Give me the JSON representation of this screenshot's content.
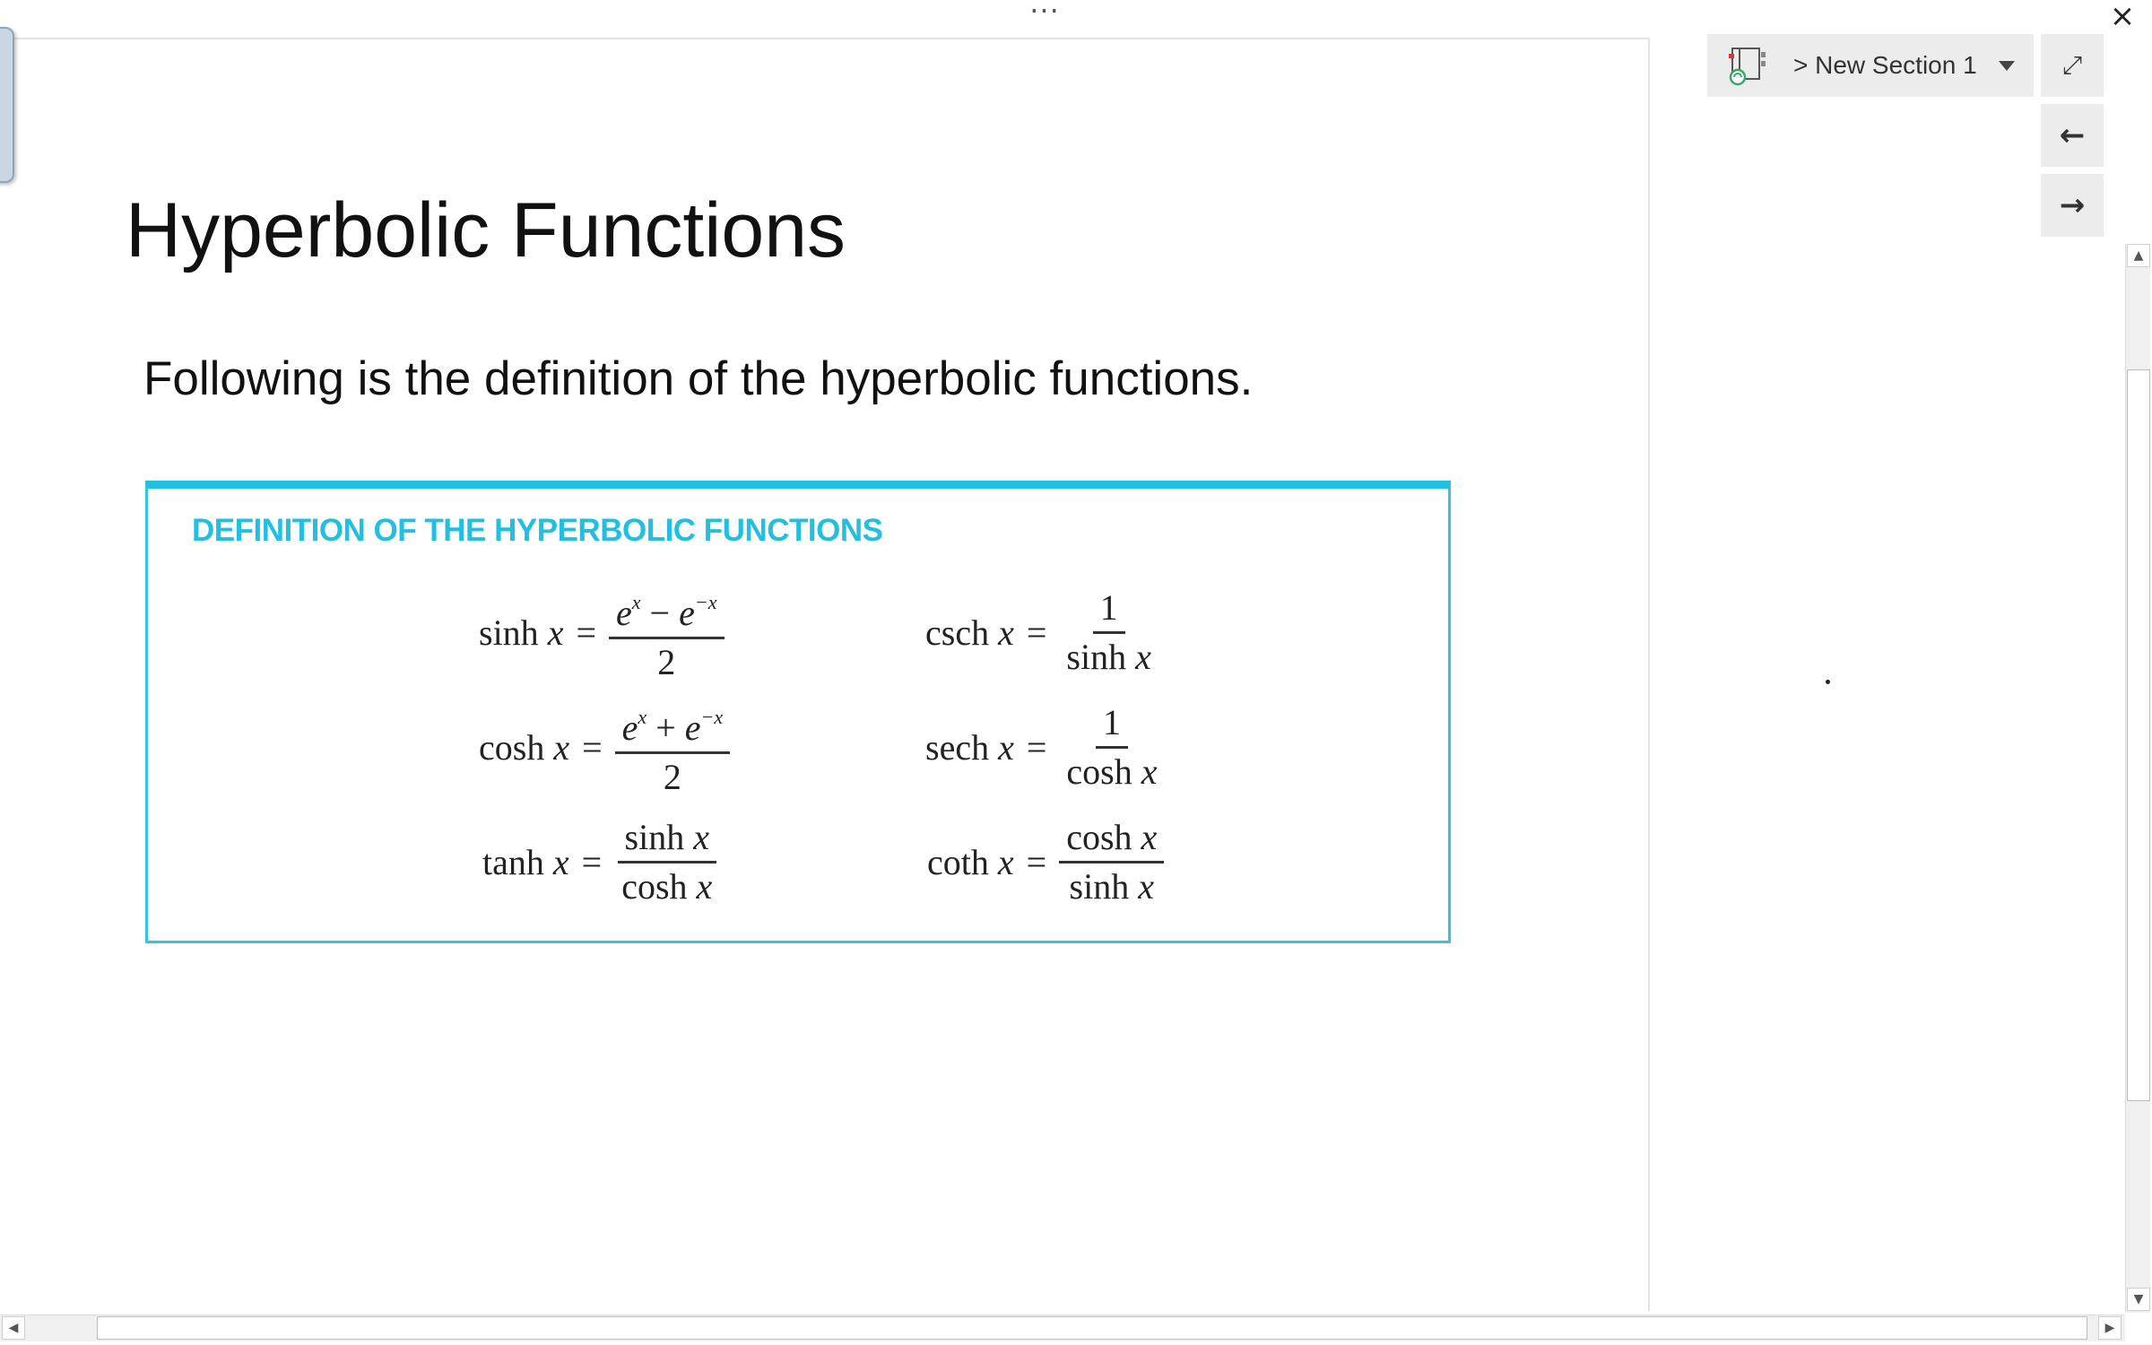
{
  "window": {
    "more_glyph": "···",
    "close_glyph": "×"
  },
  "page": {
    "title": "Hyperbolic Functions",
    "intro": "Following is the definition of the hyperbolic functions.",
    "definition": {
      "heading": "DEFINITION OF THE HYPERBOLIC FUNCTIONS",
      "formulas": {
        "sinh": {
          "name": "sinh ",
          "var": "x",
          "num_a": "e",
          "exp_a": "x",
          "op": " − ",
          "num_b": "e",
          "exp_b": "−x",
          "den": "2"
        },
        "cosh": {
          "name": "cosh ",
          "var": "x",
          "num_a": "e",
          "exp_a": "x",
          "op": " + ",
          "num_b": "e",
          "exp_b": "−x",
          "den": "2"
        },
        "tanh": {
          "name": "tanh ",
          "var": "x",
          "num_fn": "sinh ",
          "num_var": "x",
          "den_fn": "cosh ",
          "den_var": "x"
        },
        "csch": {
          "name": "csch ",
          "var": "x",
          "num": "1",
          "den_fn": "sinh ",
          "den_var": "x"
        },
        "sech": {
          "name": "sech ",
          "var": "x",
          "num": "1",
          "den_fn": "cosh ",
          "den_var": "x"
        },
        "coth": {
          "name": "coth ",
          "var": "x",
          "num_fn": "cosh ",
          "num_var": "x",
          "den_fn": "sinh ",
          "den_var": "x"
        }
      },
      "equals": "="
    }
  },
  "sidebar": {
    "section_label": "> New Section 1",
    "notebook_icon": "notebook-sync-icon",
    "expand_glyph": "⤢",
    "back_glyph": "←",
    "forward_glyph": "→"
  },
  "scrollbars": {
    "up": "▲",
    "down": "▼",
    "left": "◀",
    "right": "▶"
  }
}
